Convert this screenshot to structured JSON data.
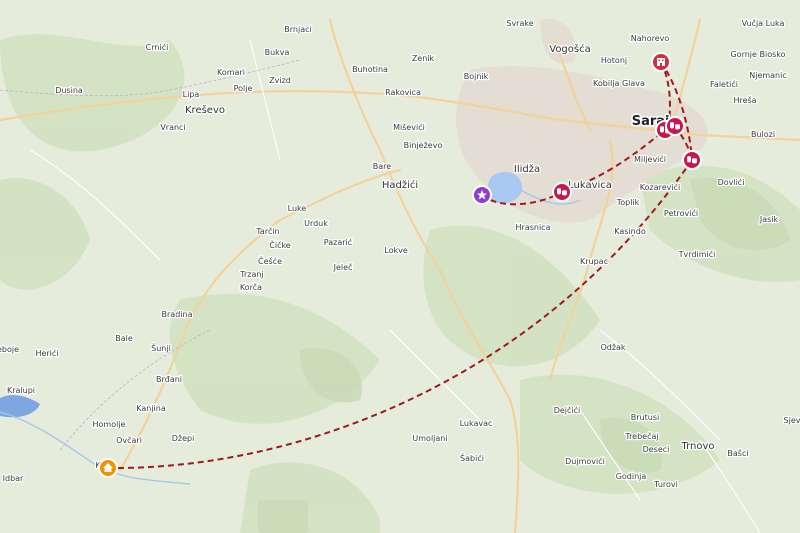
{
  "map": {
    "places": [
      {
        "name": "Svrake",
        "type": "village"
      },
      {
        "name": "Brnjaci",
        "type": "village"
      },
      {
        "name": "Vogošća",
        "type": "town"
      },
      {
        "name": "Nahorevo",
        "type": "village"
      },
      {
        "name": "Vučja Luka",
        "type": "village"
      },
      {
        "name": "Crnići",
        "type": "village"
      },
      {
        "name": "Bukva",
        "type": "village"
      },
      {
        "name": "Zenik",
        "type": "village"
      },
      {
        "name": "Hotonj",
        "type": "village"
      },
      {
        "name": "Gornje Biosko",
        "type": "village"
      },
      {
        "name": "Komari",
        "type": "village"
      },
      {
        "name": "Buhotina",
        "type": "village"
      },
      {
        "name": "Bojnik",
        "type": "village"
      },
      {
        "name": "Kobilja Glava",
        "type": "village"
      },
      {
        "name": "Njemanic",
        "type": "village"
      },
      {
        "name": "Dusina",
        "type": "village"
      },
      {
        "name": "Polje",
        "type": "village"
      },
      {
        "name": "Zvizd",
        "type": "village"
      },
      {
        "name": "Rakovica",
        "type": "village"
      },
      {
        "name": "Faletići",
        "type": "village"
      },
      {
        "name": "Lipa",
        "type": "village"
      },
      {
        "name": "Hreša",
        "type": "village"
      },
      {
        "name": "Kreševo",
        "type": "town"
      },
      {
        "name": "Vranci",
        "type": "village"
      },
      {
        "name": "Miševići",
        "type": "village"
      },
      {
        "name": "Saraje",
        "type": "city"
      },
      {
        "name": "Bulozi",
        "type": "village"
      },
      {
        "name": "Binježevo",
        "type": "village"
      },
      {
        "name": "Ilidža",
        "type": "town"
      },
      {
        "name": "Miljevići",
        "type": "village"
      },
      {
        "name": "Bare",
        "type": "village"
      },
      {
        "name": "Hadžići",
        "type": "town"
      },
      {
        "name": "Lukavica",
        "type": "town"
      },
      {
        "name": "Dovlići",
        "type": "village"
      },
      {
        "name": "Kozarevići",
        "type": "village"
      },
      {
        "name": "Toplik",
        "type": "village"
      },
      {
        "name": "Luke",
        "type": "village"
      },
      {
        "name": "Urduk",
        "type": "village"
      },
      {
        "name": "Petrovići",
        "type": "village"
      },
      {
        "name": "Jasik",
        "type": "village"
      },
      {
        "name": "Tarčin",
        "type": "village"
      },
      {
        "name": "Hrasnica",
        "type": "village"
      },
      {
        "name": "Kasindo",
        "type": "village"
      },
      {
        "name": "Čičke",
        "type": "village"
      },
      {
        "name": "Pazarić",
        "type": "village"
      },
      {
        "name": "Lokve",
        "type": "village"
      },
      {
        "name": "Tvrdimići",
        "type": "village"
      },
      {
        "name": "Češće",
        "type": "village"
      },
      {
        "name": "Krupac",
        "type": "village"
      },
      {
        "name": "Jeleč",
        "type": "village"
      },
      {
        "name": "Trzanj",
        "type": "village"
      },
      {
        "name": "Korča",
        "type": "village"
      },
      {
        "name": "Bradina",
        "type": "village"
      },
      {
        "name": "Bale",
        "type": "village"
      },
      {
        "name": "eboje",
        "type": "village"
      },
      {
        "name": "Herići",
        "type": "village"
      },
      {
        "name": "Šunji",
        "type": "village"
      },
      {
        "name": "Odžak",
        "type": "village"
      },
      {
        "name": "Kralupi",
        "type": "village"
      },
      {
        "name": "Brđani",
        "type": "village"
      },
      {
        "name": "Kanjina",
        "type": "village"
      },
      {
        "name": "Dejčići",
        "type": "village"
      },
      {
        "name": "Brutusi",
        "type": "village"
      },
      {
        "name": "Homolje",
        "type": "village"
      },
      {
        "name": "Sjev",
        "type": "village"
      },
      {
        "name": "Trebečaj",
        "type": "village"
      },
      {
        "name": "Ovčari",
        "type": "village"
      },
      {
        "name": "Džepi",
        "type": "village"
      },
      {
        "name": "Umoljani",
        "type": "village"
      },
      {
        "name": "Desеci",
        "type": "village"
      },
      {
        "name": "Trnovo",
        "type": "town"
      },
      {
        "name": "Lukavac",
        "type": "village"
      },
      {
        "name": "Bašci",
        "type": "village"
      },
      {
        "name": "K",
        "type": "village"
      },
      {
        "name": "Šabići",
        "type": "village"
      },
      {
        "name": "Dujmovići",
        "type": "village"
      },
      {
        "name": "Idbar",
        "type": "village"
      },
      {
        "name": "Godinja",
        "type": "village"
      },
      {
        "name": "Turovi",
        "type": "village"
      },
      {
        "name": "Ra",
        "type": "village"
      },
      {
        "name": "Ras",
        "type": "village"
      }
    ],
    "markers": [
      {
        "name": "home",
        "icon": "home-icon",
        "color": "#f39200"
      },
      {
        "name": "star",
        "icon": "star-icon",
        "color": "#8e3fd1"
      },
      {
        "name": "hotel",
        "icon": "hotel-icon",
        "color": "#d12d3f"
      },
      {
        "name": "theater-1",
        "icon": "theater-icon",
        "color": "#c8174d"
      },
      {
        "name": "theater-2",
        "icon": "theater-icon",
        "color": "#c8174d"
      },
      {
        "name": "theater-3",
        "icon": "theater-icon",
        "color": "#c8174d"
      },
      {
        "name": "theater-4",
        "icon": "theater-icon",
        "color": "#c8174d"
      }
    ],
    "route": {
      "color": "#9b1c1c",
      "style": "dashed"
    }
  }
}
